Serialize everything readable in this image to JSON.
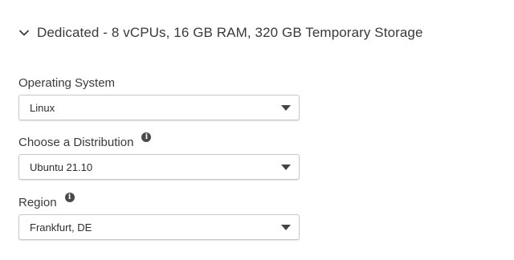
{
  "section": {
    "title": "Dedicated - 8 vCPUs, 16 GB RAM, 320 GB Temporary Storage",
    "expanded": true,
    "icon": "chevron-down-icon"
  },
  "fields": [
    {
      "label": "Operating System",
      "has_info": false,
      "value": "Linux"
    },
    {
      "label": "Choose a Distribution",
      "has_info": true,
      "value": "Ubuntu 21.10"
    },
    {
      "label": "Region",
      "has_info": true,
      "value": "Frankfurt, DE"
    }
  ],
  "info_icon_glyph": "i",
  "colors": {
    "text": "#3a3a3a",
    "border": "#c8c8c8",
    "info_icon": "#4a4a4a"
  }
}
